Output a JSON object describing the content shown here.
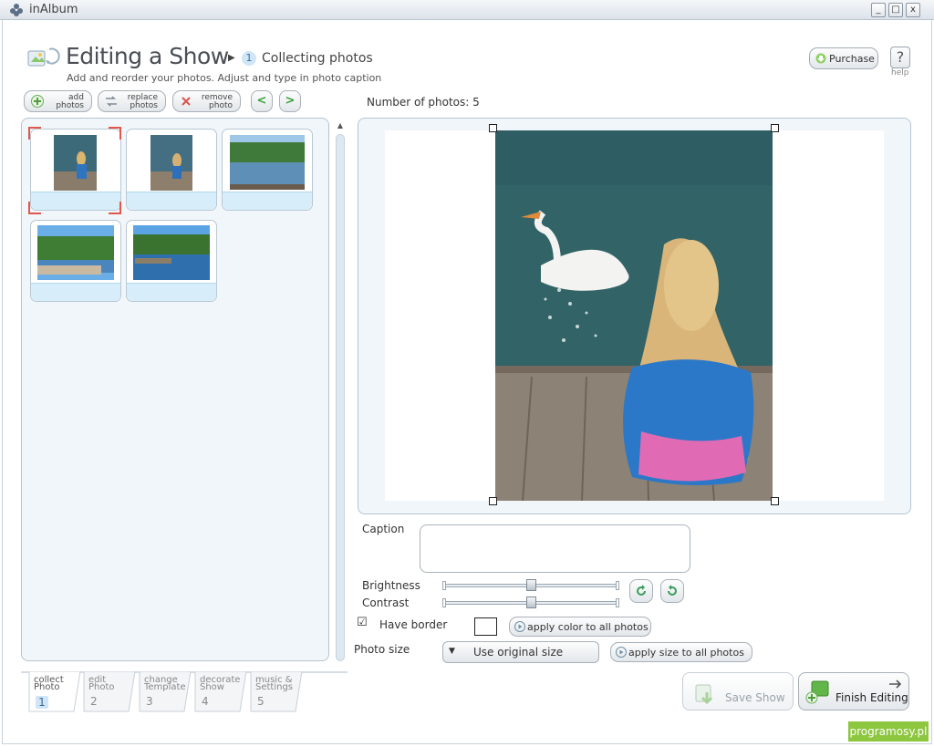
{
  "window": {
    "title": "inAlbum",
    "minimize": "_",
    "maximize": "□",
    "close": "x"
  },
  "header": {
    "title": "Editing a Show",
    "step_number": "1",
    "step_label": "Collecting photos",
    "subtitle": "Add and reorder your photos. Adjust and type in photo caption",
    "purchase_label": "Purchase",
    "help_symbol": "?",
    "help_label": "help"
  },
  "toolbar": {
    "add": [
      "add",
      "photos"
    ],
    "replace": [
      "replace",
      "photos"
    ],
    "remove": [
      "remove",
      "photo"
    ],
    "prev_symbol": "<",
    "next_symbol": ">"
  },
  "photo_count_label": "Number of photos: 5",
  "thumbnails": [
    {
      "index": 1,
      "selected": true
    },
    {
      "index": 2,
      "selected": false
    },
    {
      "index": 3,
      "selected": false
    },
    {
      "index": 4,
      "selected": false
    },
    {
      "index": 5,
      "selected": false
    }
  ],
  "tabs": [
    {
      "line1": "collect",
      "line2": "Photo",
      "number": "1",
      "active": true
    },
    {
      "line1": "edit",
      "line2": "Photo",
      "number": "2",
      "active": false
    },
    {
      "line1": "change",
      "line2": "Template",
      "number": "3",
      "active": false
    },
    {
      "line1": "decorate",
      "line2": "Show",
      "number": "4",
      "active": false
    },
    {
      "line1": "music &",
      "line2": "Settings",
      "number": "5",
      "active": false
    }
  ],
  "controls": {
    "caption_label": "Caption",
    "caption_value": "",
    "brightness_label": "Brightness",
    "brightness_value": 0.5,
    "contrast_label": "Contrast",
    "contrast_value": 0.5,
    "have_border_label": "Have border",
    "have_border_checked": true,
    "border_color": "#ffffff",
    "apply_color_label": "apply color to all photos",
    "photo_size_label": "Photo size",
    "photo_size_value": "Use original size",
    "apply_size_label": "apply size to all photos"
  },
  "actions": {
    "save_label": "Save Show",
    "finish_label": "Finish Editing"
  },
  "watermark": "programosy.pl",
  "colors": {
    "accent_green": "#39a43c",
    "panel_bg": "#f1f6fa",
    "selection_red": "#e2574c",
    "watermark_green": "#8dc63f"
  }
}
